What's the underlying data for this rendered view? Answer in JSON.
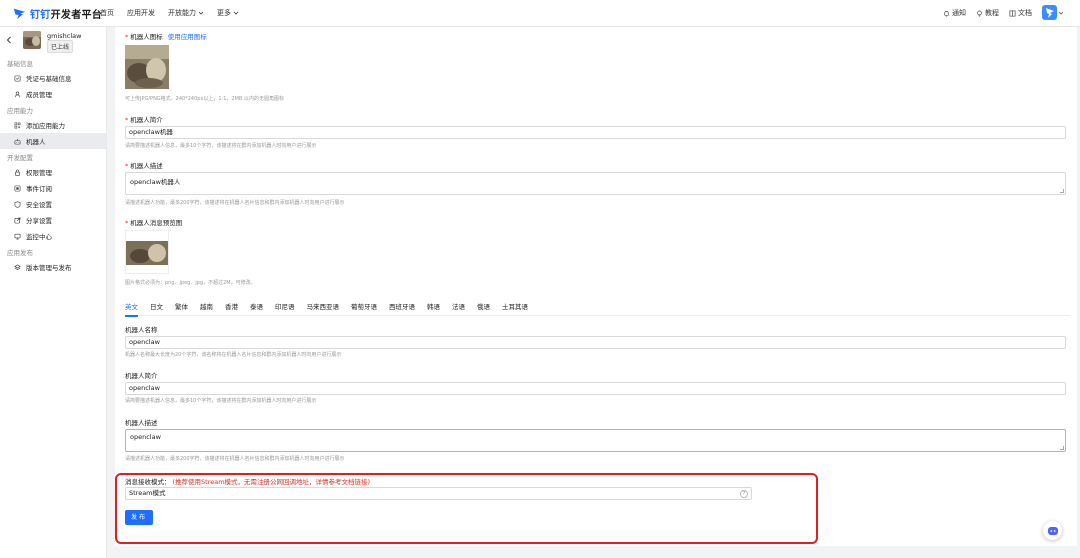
{
  "topbar": {
    "brand_name": "钉钉",
    "platform_name": "开发者平台",
    "nav": [
      "首页",
      "应用开发",
      "开放能力",
      "更多"
    ],
    "right": {
      "notify": "通知",
      "tutorial": "教程",
      "docs": "文档"
    }
  },
  "sidebar": {
    "app_name": "gmishclaw",
    "app_status": "已上线",
    "sections": [
      {
        "title": "基础信息",
        "items": [
          "凭证与基础信息",
          "成员管理"
        ]
      },
      {
        "title": "应用能力",
        "items": [
          "添加应用能力",
          "机器人"
        ]
      },
      {
        "title": "开发配置",
        "items": [
          "权限管理",
          "事件订阅",
          "安全设置",
          "分享设置",
          "监控中心"
        ]
      },
      {
        "title": "应用发布",
        "items": [
          "版本管理与发布"
        ]
      }
    ],
    "active_item": "机器人"
  },
  "form": {
    "icon_label": "机器人图标",
    "icon_link": "使用应用图标",
    "icon_hint": "可上传JPG/PNG格式，240*240px以上，1:1，2MB 以内的无圆角图标",
    "intro_label": "机器人简介",
    "intro_value": "openclaw机器",
    "intro_hint": "请简要描述机器人信息，最多10个字符，该描述将在群内添加机器人时向用户进行展示",
    "desc_label": "机器人描述",
    "desc_value": "openclaw机器人",
    "desc_hint": "请描述机器人功能，最多200字符，该描述将在机器人名片信息和群内添加机器人时向用户进行展示",
    "preview_label": "机器人消息预览图",
    "preview_hint": "图片格式必须为：png、jpeg、jpg，不超过2M，可修改。"
  },
  "languages": {
    "tabs": [
      "英文",
      "日文",
      "繁体",
      "越南",
      "香港",
      "泰语",
      "印尼语",
      "马来西亚语",
      "葡萄牙语",
      "西班牙语",
      "韩语",
      "法语",
      "俄语",
      "土耳其语"
    ],
    "active": "英文",
    "name_label": "机器人名称",
    "name_value": "openclaw",
    "name_hint": "机器人名称最大长度为20个字符，该名称将在机器人名片信息和群内添加机器人时向用户进行展示",
    "intro_label": "机器人简介",
    "intro_value": "openclaw",
    "intro_hint": "请简要描述机器人信息，最多10个字符，该描述将在群内添加机器人时向用户进行展示",
    "desc_label": "机器人描述",
    "desc_value": "openclaw",
    "desc_hint": "请描述机器人功能，最多200字符，该描述将在机器人名片信息和群内添加机器人时向用户进行展示"
  },
  "message_mode": {
    "label": "消息接收模式：",
    "note": "(推荐使用Stream模式，无需注册公网回调地址，详情参考文档链接)",
    "value": "Stream模式",
    "help": "?",
    "publish_label": "发布"
  },
  "colors": {
    "accent": "#1f6fff",
    "required": "#e0301e",
    "highlight_border": "#e02020"
  }
}
